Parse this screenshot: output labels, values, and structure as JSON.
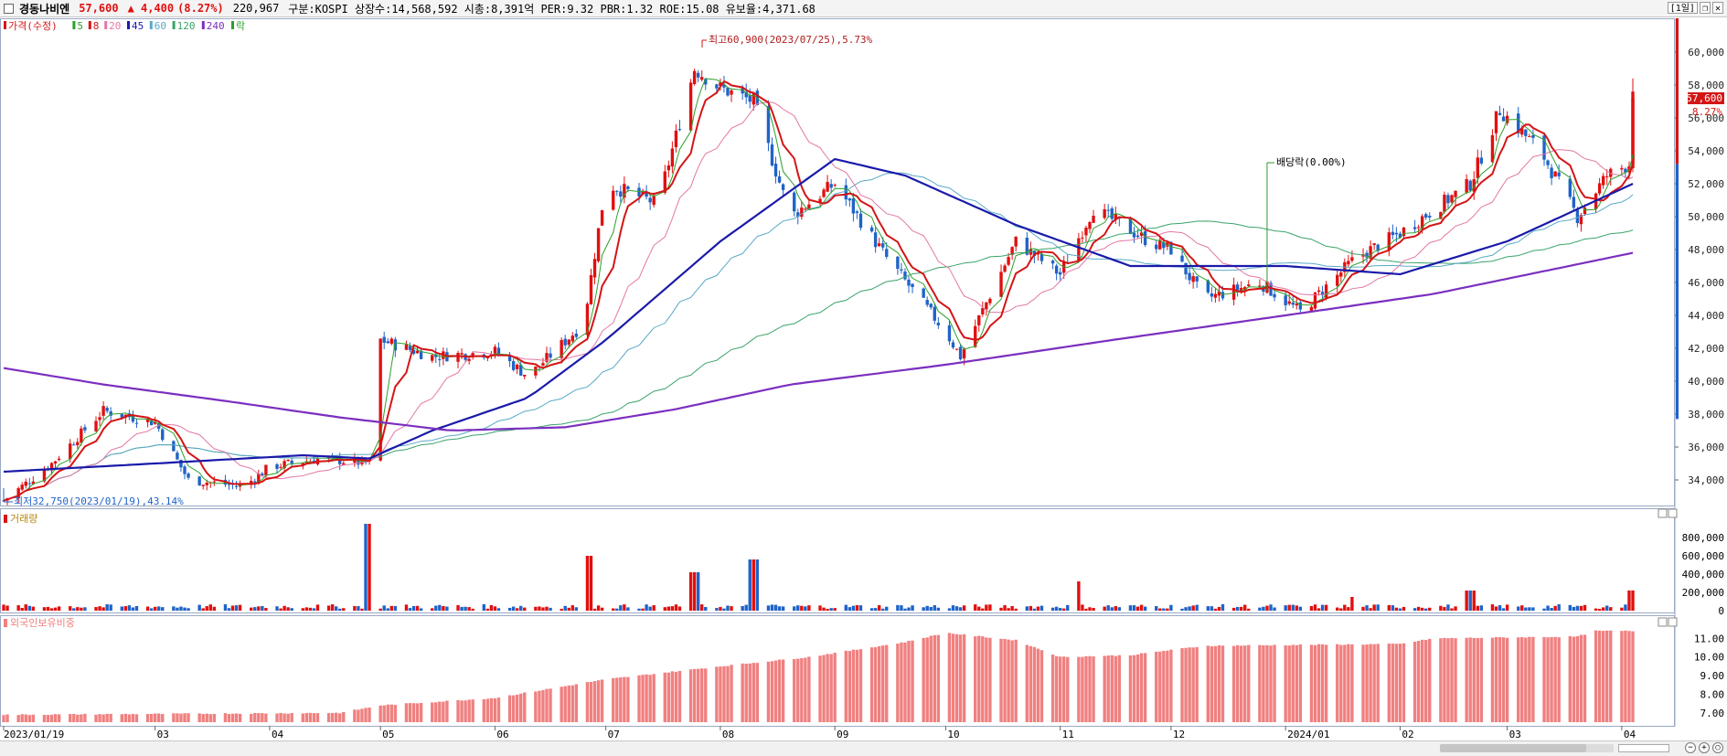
{
  "header": {
    "name": "경동나비엔",
    "price": "57,600",
    "change": "▲ 4,400",
    "change_pct": "(8.27%)",
    "volume": "220,967",
    "info": "구분:KOSPI 상장수:14,568,592 시총:8,391억 PER:9.32 PBR:1.32 ROE:15.08 유보율:4,371.68",
    "period_button": "[1일]"
  },
  "legend": [
    {
      "label": "가격(수정)",
      "color": "#d41515"
    },
    {
      "label": "5",
      "color": "#2ca02c"
    },
    {
      "label": "8",
      "color": "#d41515"
    },
    {
      "label": "20",
      "color": "#e377a5"
    },
    {
      "label": "45",
      "color": "#1a1aaa"
    },
    {
      "label": "60",
      "color": "#5aa9c7"
    },
    {
      "label": "120",
      "color": "#3aa36a"
    },
    {
      "label": "240",
      "color": "#7b2fbf"
    },
    {
      "label": "락",
      "color": "#2ca02c"
    }
  ],
  "annotations": {
    "high": "최고60,900(2023/07/25),5.73%",
    "low": "최저32,750(2023/01/19),43.14%",
    "dividend": "배당락(0.00%)"
  },
  "panels": {
    "volume_title": "거래량",
    "foreign_title": "외국인보유비중"
  },
  "price_tag": {
    "price": "57,600",
    "pct": "8.27%"
  },
  "colors": {
    "up": "#e01010",
    "down": "#1f63c8",
    "ma45": "#1a1aaa",
    "ma240": "#7b2fbf",
    "foreign": "#f08080"
  },
  "chart_data": [
    {
      "type": "candlestick",
      "title": "경동나비엔",
      "x_ticks": [
        "2023/01/19",
        "03",
        "04",
        "05",
        "06",
        "07",
        "08",
        "09",
        "10",
        "11",
        "12",
        "2024/01",
        "02",
        "03",
        "04"
      ],
      "y_ticks": [
        "34,000",
        "36,000",
        "38,000",
        "40,000",
        "42,000",
        "44,000",
        "46,000",
        "48,000",
        "50,000",
        "52,000",
        "54,000",
        "56,000",
        "58,000",
        "60,000"
      ],
      "ylim": [
        32500,
        61500
      ],
      "close_path": [
        [
          "2023/01/19",
          32750
        ],
        [
          "2023/02/01",
          35000
        ],
        [
          "2023/02/15",
          38200
        ],
        [
          "2023/03/01",
          37500
        ],
        [
          "2023/03/10",
          34000
        ],
        [
          "2023/03/25",
          33600
        ],
        [
          "2023/04/01",
          34800
        ],
        [
          "2023/04/15",
          35300
        ],
        [
          "2023/04/28",
          35000
        ],
        [
          "2023/05/01",
          42500
        ],
        [
          "2023/05/15",
          41500
        ],
        [
          "2023/06/01",
          41800
        ],
        [
          "2023/06/10",
          40300
        ],
        [
          "2023/06/25",
          43500
        ],
        [
          "2023/07/01",
          52000
        ],
        [
          "2023/07/15",
          50800
        ],
        [
          "2023/07/25",
          59000
        ],
        [
          "2023/08/01",
          57800
        ],
        [
          "2023/08/10",
          57000
        ],
        [
          "2023/08/20",
          50000
        ],
        [
          "2023/09/01",
          52000
        ],
        [
          "2023/09/15",
          47500
        ],
        [
          "2023/10/01",
          43000
        ],
        [
          "2023/10/05",
          41500
        ],
        [
          "2023/10/20",
          48500
        ],
        [
          "2023/11/01",
          46500
        ],
        [
          "2023/11/10",
          50500
        ],
        [
          "2023/11/25",
          48500
        ],
        [
          "2023/12/01",
          48000
        ],
        [
          "2023/12/10",
          45000
        ],
        [
          "2023/12/25",
          46000
        ],
        [
          "2024/01/05",
          44200
        ],
        [
          "2024/01/20",
          47500
        ],
        [
          "2024/02/01",
          49000
        ],
        [
          "2024/02/20",
          52000
        ],
        [
          "2024/02/28",
          56500
        ],
        [
          "2024/03/10",
          54000
        ],
        [
          "2024/03/20",
          50000
        ],
        [
          "2024/03/28",
          52500
        ],
        [
          "2024/04/03",
          53200
        ],
        [
          "2024/04/04",
          57600
        ]
      ],
      "ma45": [
        [
          "2023/01/19",
          34500
        ],
        [
          "2023/03/01",
          35000
        ],
        [
          "2023/04/10",
          35500
        ],
        [
          "2023/04/28",
          35300
        ],
        [
          "2023/05/15",
          37000
        ],
        [
          "2023/06/10",
          39000
        ],
        [
          "2023/07/01",
          42500
        ],
        [
          "2023/08/01",
          48500
        ],
        [
          "2023/09/01",
          53500
        ],
        [
          "2023/09/20",
          52500
        ],
        [
          "2023/10/20",
          49500
        ],
        [
          "2023/11/20",
          47000
        ],
        [
          "2024/01/01",
          47000
        ],
        [
          "2024/02/01",
          46500
        ],
        [
          "2024/03/01",
          48500
        ],
        [
          "2024/04/04",
          52000
        ]
      ],
      "ma240": [
        [
          "2023/01/19",
          40800
        ],
        [
          "2023/02/15",
          39800
        ],
        [
          "2023/03/20",
          38800
        ],
        [
          "2023/04/20",
          37800
        ],
        [
          "2023/05/20",
          37000
        ],
        [
          "2023/06/20",
          37200
        ],
        [
          "2023/07/20",
          38300
        ],
        [
          "2023/08/20",
          39800
        ],
        [
          "2023/10/01",
          41000
        ],
        [
          "2023/11/15",
          42500
        ],
        [
          "2024/01/01",
          44000
        ],
        [
          "2024/02/10",
          45300
        ],
        [
          "2024/04/04",
          47800
        ]
      ],
      "dividend_date": "2023/12/27"
    },
    {
      "type": "bar",
      "title": "거래량",
      "y_ticks": [
        "0",
        "200,000",
        "400,000",
        "600,000",
        "800,000"
      ],
      "ylim": [
        0,
        1000000
      ],
      "spikes": [
        [
          "2023/04/28",
          950000
        ],
        [
          "2023/06/26",
          600000
        ],
        [
          "2023/07/25",
          420000
        ],
        [
          "2023/08/10",
          560000
        ],
        [
          "2023/11/05",
          320000
        ],
        [
          "2024/01/20",
          150000
        ],
        [
          "2024/02/20",
          220000
        ],
        [
          "2024/04/04",
          220967
        ]
      ]
    },
    {
      "type": "bar",
      "title": "외국인보유비중",
      "y_ticks": [
        "7.00",
        "8.00",
        "9.00",
        "10.00",
        "11.00"
      ],
      "ylim": [
        6.5,
        11.9
      ],
      "path": [
        [
          "2023/01/19",
          6.9
        ],
        [
          "2023/04/20",
          7.0
        ],
        [
          "2023/05/01",
          7.4
        ],
        [
          "2023/06/01",
          7.8
        ],
        [
          "2023/07/01",
          8.8
        ],
        [
          "2023/08/01",
          9.5
        ],
        [
          "2023/08/25",
          10.0
        ],
        [
          "2023/09/20",
          10.8
        ],
        [
          "2023/10/01",
          11.3
        ],
        [
          "2023/10/20",
          10.9
        ],
        [
          "2023/11/01",
          10.0
        ],
        [
          "2023/11/20",
          10.1
        ],
        [
          "2023/12/10",
          10.6
        ],
        [
          "2024/02/01",
          10.7
        ],
        [
          "2024/02/10",
          11.0
        ],
        [
          "2024/03/20",
          11.1
        ],
        [
          "2024/03/25",
          11.4
        ],
        [
          "2024/04/04",
          11.4
        ]
      ]
    }
  ]
}
